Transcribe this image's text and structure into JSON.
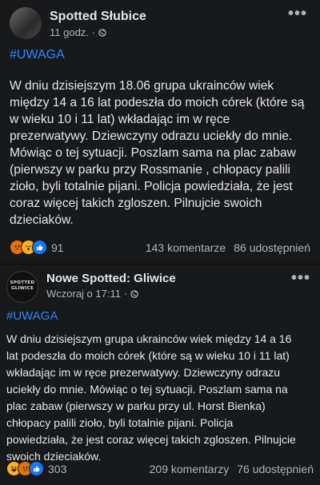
{
  "post1": {
    "page_name": "Spotted Słubice",
    "time": "11 godz. ·",
    "hashtag": "#UWAGA",
    "lines": [
      "W dniu dzisiejszym 18.06 grupa ukrainców wiek",
      "między 14 a 16 lat podeszła do moich córek (które są",
      "w wieku 10 i 11 lat) wkładając im w ręce",
      "prezerwatywy. Dziewczyny odrazu uciekły do mnie.",
      "Mówiąc o tej sytuacji. Poszlam sama na plac zabaw",
      "(pierwszy w parku przy Rossmanie , chłopacy palili",
      "zioło, byli totalnie pijani. Policja powiedziała, że jest",
      "coraz więcej takich zgloszen. Pilnujcie swoich",
      "dzieciaków."
    ],
    "reactions": [
      "angry-reaction-icon",
      "wow-reaction-icon",
      "like-reaction-icon"
    ],
    "reaction_count": "91",
    "comments": "143 komentarze",
    "shares": "86 udostępnień"
  },
  "post2": {
    "page_name": "Nowe Spotted: Gliwice",
    "avatar_text": "SPOTTED GLIWICE",
    "time": "Wczoraj o 17:11 ·",
    "hashtag": "#UWAGA",
    "lines": [
      "W dniu dzisiejszym grupa ukrainców wiek między 14 a 16",
      "lat podeszła do moich córek (które są w wieku 10 i 11 lat)",
      "wkładając im w ręce prezerwatywy. Dziewczyny odrazu",
      "uciekły do mnie. Mówiąc o tej sytuacji. Poszlam sama na",
      "plac zabaw (pierwszy w parku przy ul. Horst Bienka)",
      "chłopacy palili zioło, byli totalnie pijani. Policja",
      "powiedziała, że jest coraz więcej takich zgloszen. Pilnujcie",
      "swoich dzieciaków."
    ],
    "reactions": [
      "haha-reaction-icon",
      "angry-reaction-icon",
      "like-reaction-icon"
    ],
    "reaction_count": "303",
    "comments": "209 komentarzy",
    "shares": "76 udostępnień"
  },
  "colors": {
    "background": "#18191a",
    "text": "#e4e6eb",
    "secondary_text": "#b0b3b8",
    "hashtag": "#2d88ff"
  }
}
